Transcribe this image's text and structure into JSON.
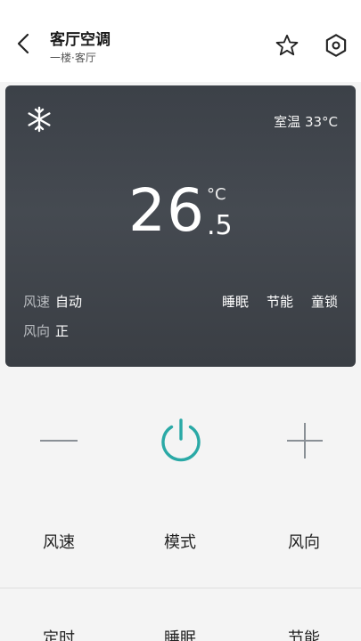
{
  "header": {
    "title": "客厅空调",
    "subtitle": "一楼·客厅"
  },
  "status": {
    "room_label": "室温",
    "room_temp": "33°C",
    "set_temp_int": "26",
    "set_temp_dec": ".5",
    "set_temp_unit": "°C",
    "fan_speed_label": "风速",
    "fan_speed_value": "自动",
    "fan_dir_label": "风向",
    "fan_dir_value": "正",
    "features": [
      "睡眠",
      "节能",
      "童锁"
    ]
  },
  "controls": {
    "row1": [
      "风速",
      "模式",
      "风向"
    ],
    "row2": [
      "定时",
      "睡眠",
      "节能"
    ]
  },
  "colors": {
    "accent": "#2aa9a6",
    "card_bg": "#41464c"
  },
  "icons": {
    "back": "chevron-left-icon",
    "star": "star-icon",
    "settings": "hexagon-settings-icon",
    "mode": "snowflake-icon",
    "power": "power-icon",
    "minus": "minus-icon",
    "plus": "plus-icon"
  }
}
